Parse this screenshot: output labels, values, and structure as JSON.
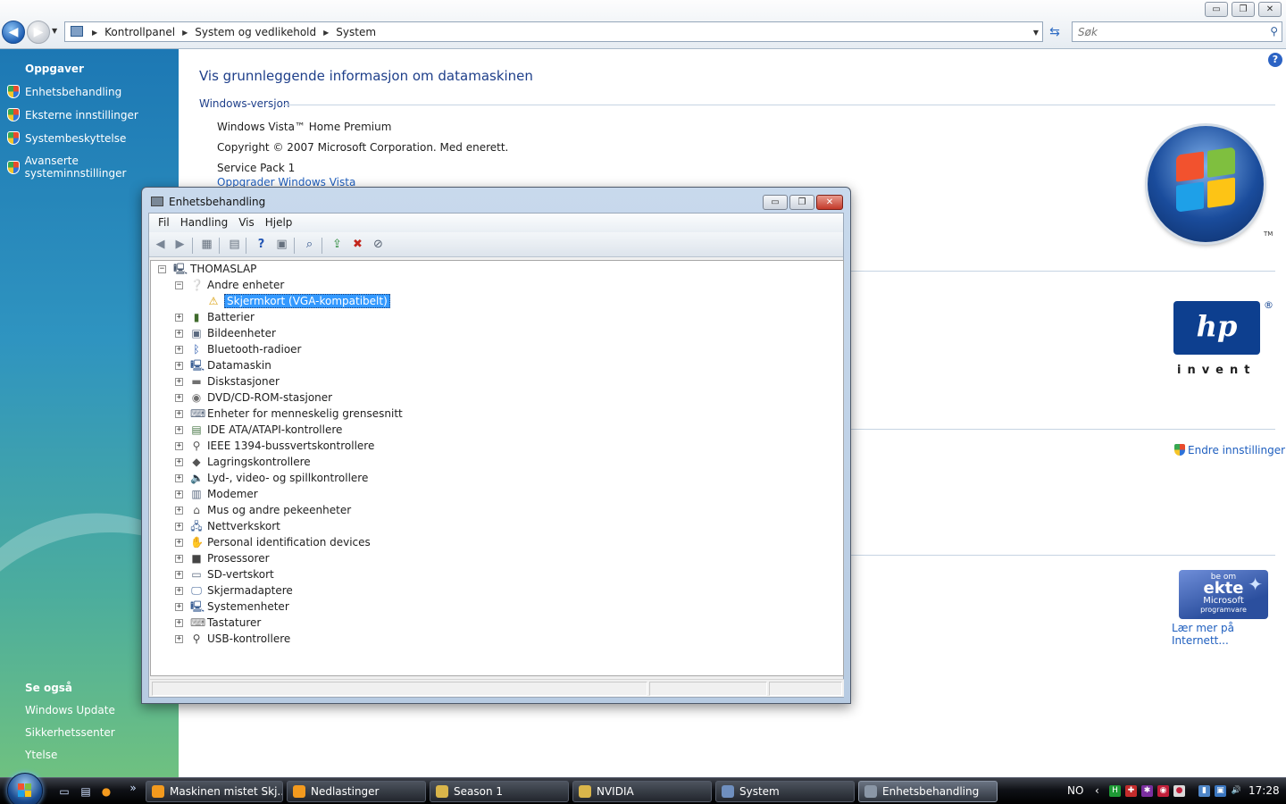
{
  "address": {
    "crumbs": [
      "Kontrollpanel",
      "System og vedlikehold",
      "System"
    ],
    "search_placeholder": "Søk"
  },
  "window_controls": {
    "minimize": "▭",
    "restore": "❐",
    "close": "✕"
  },
  "taskpane": {
    "tasks_heading": "Oppgaver",
    "tasks": [
      "Enhetsbehandling",
      "Eksterne innstillinger",
      "Systembeskyttelse",
      "Avanserte systeminnstillinger"
    ],
    "see_also_heading": "Se også",
    "see_also": [
      "Windows Update",
      "Sikkerhetssenter",
      "Ytelse"
    ]
  },
  "main": {
    "title": "Vis grunnleggende informasjon om datamaskinen",
    "section": "Windows-versjon",
    "edition": "Windows Vista™ Home Premium",
    "copyright": "Copyright © 2007 Microsoft Corporation. Med enerett.",
    "service_pack": "Service Pack 1",
    "upgrade_link": "Oppgrader Windows Vista",
    "tm": "TM",
    "hp_text": "hp",
    "hp_reg": "®",
    "hp_invent": "invent",
    "change_settings": "Endre innstillinger",
    "genuine": {
      "line1": "be om",
      "line2": "ekte",
      "line3": "Microsoft",
      "line4": "programvare"
    },
    "learn_more": "Lær mer på Internett..."
  },
  "devmgr": {
    "title": "Enhetsbehandling",
    "menu": [
      "Fil",
      "Handling",
      "Vis",
      "Hjelp"
    ],
    "root": "THOMASLAP",
    "expanded_category": "Andre enheter",
    "selected_device": "Skjermkort (VGA-kompatibelt)",
    "categories": [
      "Batterier",
      "Bildeenheter",
      "Bluetooth-radioer",
      "Datamaskin",
      "Diskstasjoner",
      "DVD/CD-ROM-stasjoner",
      "Enheter for menneskelig grensesnitt",
      "IDE ATA/ATAPI-kontrollere",
      "IEEE 1394-bussvertskontrollere",
      "Lagringskontrollere",
      "Lyd-, video- og spillkontrollere",
      "Modemer",
      "Mus og andre pekeenheter",
      "Nettverkskort",
      "Personal identification devices",
      "Prosessorer",
      "SD-vertskort",
      "Skjermadaptere",
      "Systemenheter",
      "Tastaturer",
      "USB-kontrollere"
    ]
  },
  "taskbar": {
    "buttons": [
      "Maskinen mistet Skj...",
      "Nedlastinger",
      "Season 1",
      "NVIDIA",
      "System",
      "Enhetsbehandling"
    ],
    "language": "NO",
    "clock": "17:28",
    "quicklaunch_more": "»"
  },
  "colors": {
    "accent": "#1f5fbf",
    "selection": "#3399ff",
    "taskpane_top": "#1d78b4",
    "taskpane_bottom": "#6fc180"
  }
}
